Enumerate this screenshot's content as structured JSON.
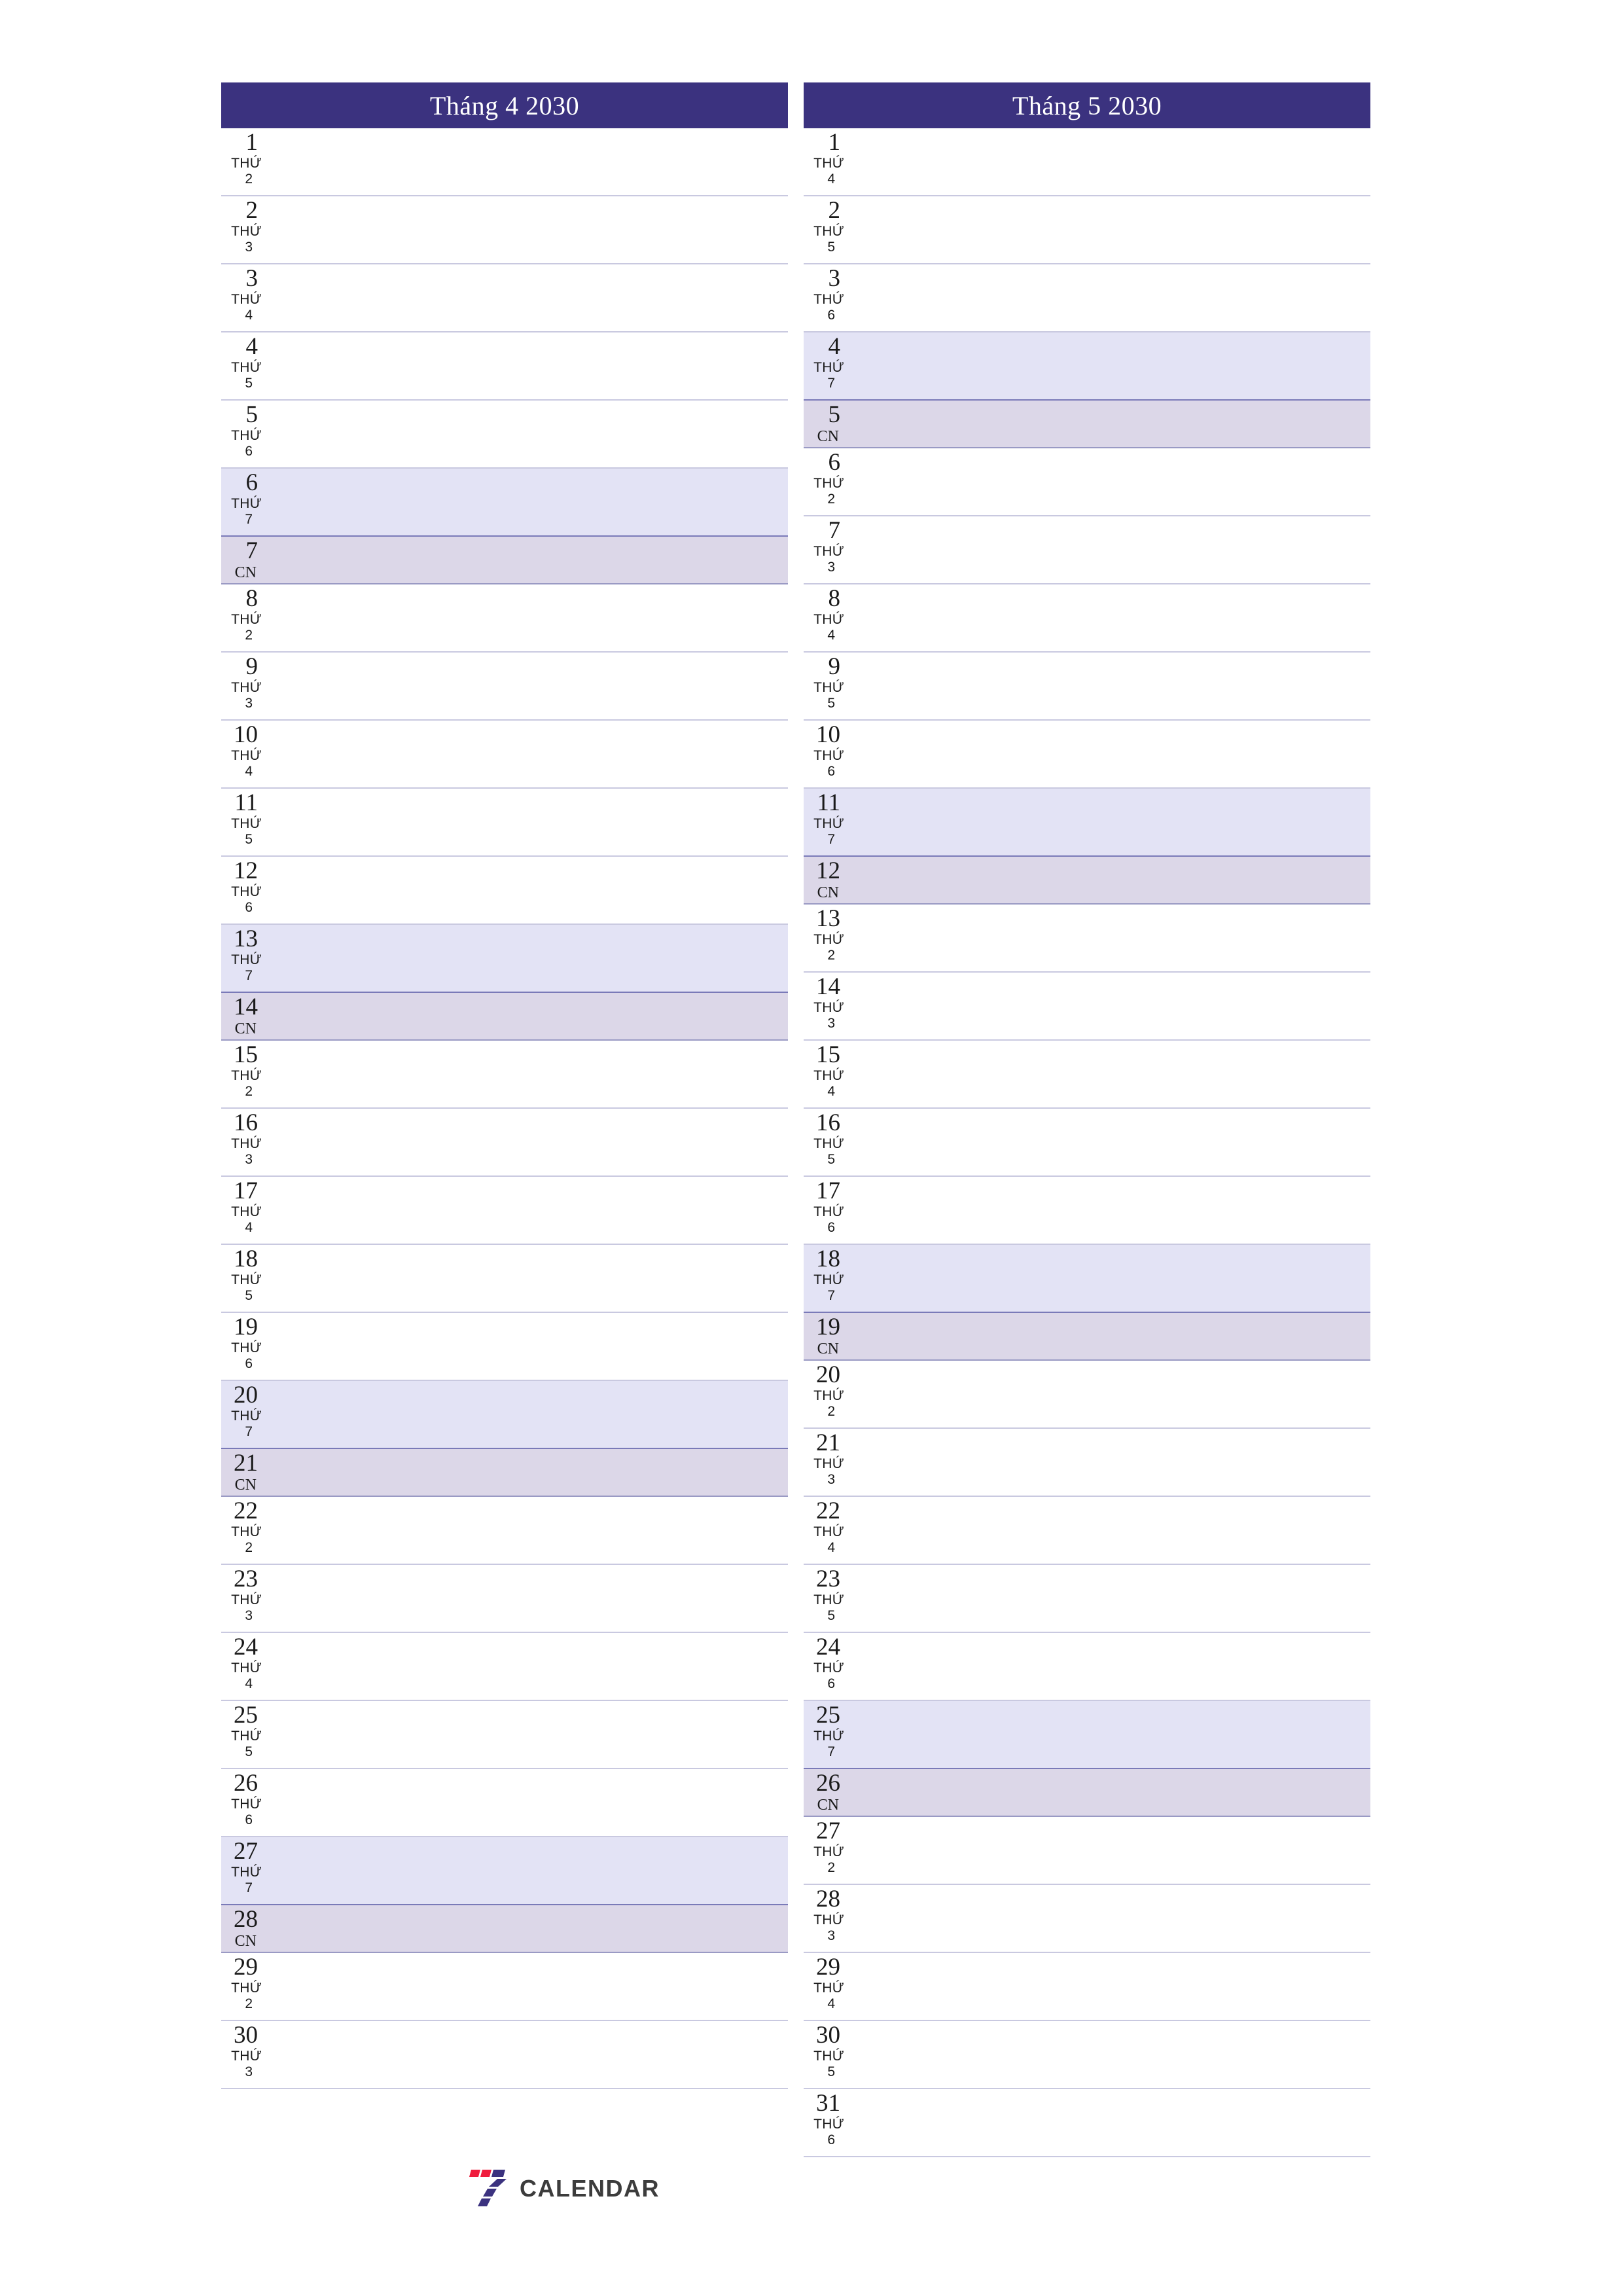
{
  "document": {
    "kind": "two-month-planner",
    "logo": {
      "mark_name": "seven-logo-mark",
      "word": "CALENDAR",
      "colors": {
        "red": "#ef1b3c",
        "indigo": "#3b327f",
        "word": "#3c3c3c"
      }
    }
  },
  "theme": {
    "header_bg": "#3b327f",
    "header_text": "#ffffff",
    "saturday_bg": "#e3e3f5",
    "sunday_bg": "#dcd7e8",
    "row_divider": "#c9c9e0",
    "weekend_divider": "#7a7ab8",
    "text": "#1a1a1a"
  },
  "labels": {
    "weekday_word": "THỨ",
    "sunday_short": "CN"
  },
  "months": [
    {
      "title": "Tháng 4 2030",
      "days": [
        {
          "day": "1",
          "dow_word": "THỨ",
          "dow_num": "2",
          "type": "weekday"
        },
        {
          "day": "2",
          "dow_word": "THỨ",
          "dow_num": "3",
          "type": "weekday"
        },
        {
          "day": "3",
          "dow_word": "THỨ",
          "dow_num": "4",
          "type": "weekday"
        },
        {
          "day": "4",
          "dow_word": "THỨ",
          "dow_num": "5",
          "type": "weekday"
        },
        {
          "day": "5",
          "dow_word": "THỨ",
          "dow_num": "6",
          "type": "weekday"
        },
        {
          "day": "6",
          "dow_word": "THỨ",
          "dow_num": "7",
          "type": "saturday"
        },
        {
          "day": "7",
          "dow_word": "CN",
          "dow_num": "",
          "type": "sunday"
        },
        {
          "day": "8",
          "dow_word": "THỨ",
          "dow_num": "2",
          "type": "weekday"
        },
        {
          "day": "9",
          "dow_word": "THỨ",
          "dow_num": "3",
          "type": "weekday"
        },
        {
          "day": "10",
          "dow_word": "THỨ",
          "dow_num": "4",
          "type": "weekday"
        },
        {
          "day": "11",
          "dow_word": "THỨ",
          "dow_num": "5",
          "type": "weekday"
        },
        {
          "day": "12",
          "dow_word": "THỨ",
          "dow_num": "6",
          "type": "weekday"
        },
        {
          "day": "13",
          "dow_word": "THỨ",
          "dow_num": "7",
          "type": "saturday"
        },
        {
          "day": "14",
          "dow_word": "CN",
          "dow_num": "",
          "type": "sunday"
        },
        {
          "day": "15",
          "dow_word": "THỨ",
          "dow_num": "2",
          "type": "weekday"
        },
        {
          "day": "16",
          "dow_word": "THỨ",
          "dow_num": "3",
          "type": "weekday"
        },
        {
          "day": "17",
          "dow_word": "THỨ",
          "dow_num": "4",
          "type": "weekday"
        },
        {
          "day": "18",
          "dow_word": "THỨ",
          "dow_num": "5",
          "type": "weekday"
        },
        {
          "day": "19",
          "dow_word": "THỨ",
          "dow_num": "6",
          "type": "weekday"
        },
        {
          "day": "20",
          "dow_word": "THỨ",
          "dow_num": "7",
          "type": "saturday"
        },
        {
          "day": "21",
          "dow_word": "CN",
          "dow_num": "",
          "type": "sunday"
        },
        {
          "day": "22",
          "dow_word": "THỨ",
          "dow_num": "2",
          "type": "weekday"
        },
        {
          "day": "23",
          "dow_word": "THỨ",
          "dow_num": "3",
          "type": "weekday"
        },
        {
          "day": "24",
          "dow_word": "THỨ",
          "dow_num": "4",
          "type": "weekday"
        },
        {
          "day": "25",
          "dow_word": "THỨ",
          "dow_num": "5",
          "type": "weekday"
        },
        {
          "day": "26",
          "dow_word": "THỨ",
          "dow_num": "6",
          "type": "weekday"
        },
        {
          "day": "27",
          "dow_word": "THỨ",
          "dow_num": "7",
          "type": "saturday"
        },
        {
          "day": "28",
          "dow_word": "CN",
          "dow_num": "",
          "type": "sunday"
        },
        {
          "day": "29",
          "dow_word": "THỨ",
          "dow_num": "2",
          "type": "weekday"
        },
        {
          "day": "30",
          "dow_word": "THỨ",
          "dow_num": "3",
          "type": "weekday"
        }
      ],
      "has_logo_slot": true
    },
    {
      "title": "Tháng 5 2030",
      "days": [
        {
          "day": "1",
          "dow_word": "THỨ",
          "dow_num": "4",
          "type": "weekday"
        },
        {
          "day": "2",
          "dow_word": "THỨ",
          "dow_num": "5",
          "type": "weekday"
        },
        {
          "day": "3",
          "dow_word": "THỨ",
          "dow_num": "6",
          "type": "weekday"
        },
        {
          "day": "4",
          "dow_word": "THỨ",
          "dow_num": "7",
          "type": "saturday"
        },
        {
          "day": "5",
          "dow_word": "CN",
          "dow_num": "",
          "type": "sunday"
        },
        {
          "day": "6",
          "dow_word": "THỨ",
          "dow_num": "2",
          "type": "weekday"
        },
        {
          "day": "7",
          "dow_word": "THỨ",
          "dow_num": "3",
          "type": "weekday"
        },
        {
          "day": "8",
          "dow_word": "THỨ",
          "dow_num": "4",
          "type": "weekday"
        },
        {
          "day": "9",
          "dow_word": "THỨ",
          "dow_num": "5",
          "type": "weekday"
        },
        {
          "day": "10",
          "dow_word": "THỨ",
          "dow_num": "6",
          "type": "weekday"
        },
        {
          "day": "11",
          "dow_word": "THỨ",
          "dow_num": "7",
          "type": "saturday"
        },
        {
          "day": "12",
          "dow_word": "CN",
          "dow_num": "",
          "type": "sunday"
        },
        {
          "day": "13",
          "dow_word": "THỨ",
          "dow_num": "2",
          "type": "weekday"
        },
        {
          "day": "14",
          "dow_word": "THỨ",
          "dow_num": "3",
          "type": "weekday"
        },
        {
          "day": "15",
          "dow_word": "THỨ",
          "dow_num": "4",
          "type": "weekday"
        },
        {
          "day": "16",
          "dow_word": "THỨ",
          "dow_num": "5",
          "type": "weekday"
        },
        {
          "day": "17",
          "dow_word": "THỨ",
          "dow_num": "6",
          "type": "weekday"
        },
        {
          "day": "18",
          "dow_word": "THỨ",
          "dow_num": "7",
          "type": "saturday"
        },
        {
          "day": "19",
          "dow_word": "CN",
          "dow_num": "",
          "type": "sunday"
        },
        {
          "day": "20",
          "dow_word": "THỨ",
          "dow_num": "2",
          "type": "weekday"
        },
        {
          "day": "21",
          "dow_word": "THỨ",
          "dow_num": "3",
          "type": "weekday"
        },
        {
          "day": "22",
          "dow_word": "THỨ",
          "dow_num": "4",
          "type": "weekday"
        },
        {
          "day": "23",
          "dow_word": "THỨ",
          "dow_num": "5",
          "type": "weekday"
        },
        {
          "day": "24",
          "dow_word": "THỨ",
          "dow_num": "6",
          "type": "weekday"
        },
        {
          "day": "25",
          "dow_word": "THỨ",
          "dow_num": "7",
          "type": "saturday"
        },
        {
          "day": "26",
          "dow_word": "CN",
          "dow_num": "",
          "type": "sunday"
        },
        {
          "day": "27",
          "dow_word": "THỨ",
          "dow_num": "2",
          "type": "weekday"
        },
        {
          "day": "28",
          "dow_word": "THỨ",
          "dow_num": "3",
          "type": "weekday"
        },
        {
          "day": "29",
          "dow_word": "THỨ",
          "dow_num": "4",
          "type": "weekday"
        },
        {
          "day": "30",
          "dow_word": "THỨ",
          "dow_num": "5",
          "type": "weekday"
        },
        {
          "day": "31",
          "dow_word": "THỨ",
          "dow_num": "6",
          "type": "weekday"
        }
      ],
      "has_logo_slot": false
    }
  ]
}
